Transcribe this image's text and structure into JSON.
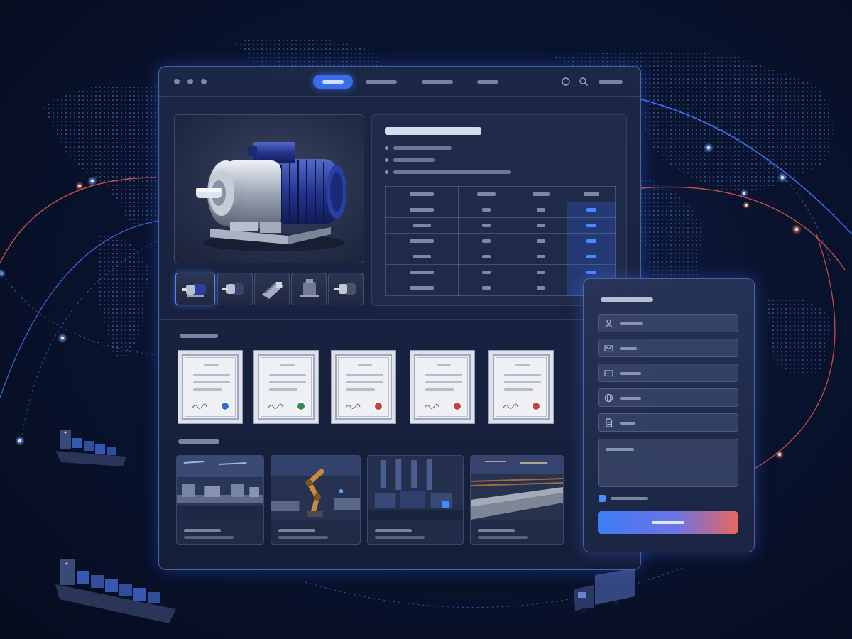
{
  "window": {
    "controls": [
      "window-dot",
      "window-dot",
      "window-dot"
    ],
    "nav_tabs": [
      {
        "label": "",
        "active": true
      },
      {
        "label": "",
        "active": false
      },
      {
        "label": "",
        "active": false
      },
      {
        "label": "",
        "active": false
      }
    ],
    "toolbar_icons": [
      "circle-icon",
      "search-icon",
      "menu-placeholder"
    ]
  },
  "product": {
    "hero_icon": "electric-motor-image",
    "thumbnails": [
      {
        "icon": "motor-thumbnail-icon",
        "active": true
      },
      {
        "icon": "motor-thumbnail-icon",
        "active": false
      },
      {
        "icon": "gearbox-thumbnail-icon",
        "active": false
      },
      {
        "icon": "motor-thumbnail-icon",
        "active": false
      },
      {
        "icon": "motor-thumbnail-icon",
        "active": false
      }
    ],
    "spec_title": "",
    "bullets": [
      "",
      "",
      ""
    ],
    "table": {
      "columns": 4,
      "rows": 6,
      "highlighted_column": 3
    }
  },
  "certificates": {
    "section_label": "",
    "items": [
      {
        "seal_color": "#2f6fd1"
      },
      {
        "seal_color": "#2e8c52"
      },
      {
        "seal_color": "#c8403a"
      },
      {
        "seal_color": "#c8403a"
      },
      {
        "seal_color": "#c8403a"
      }
    ]
  },
  "factory": {
    "section_label": "",
    "cards": [
      {
        "icon": "factory-production-line-image",
        "caption": "",
        "subcaption": ""
      },
      {
        "icon": "robotic-arm-image",
        "caption": "",
        "subcaption": ""
      },
      {
        "icon": "machinery-floor-image",
        "caption": "",
        "subcaption": ""
      },
      {
        "icon": "pipe-production-image",
        "caption": "",
        "subcaption": ""
      }
    ]
  },
  "contact_form": {
    "title": "",
    "fields": [
      {
        "icon": "user-icon",
        "placeholder": ""
      },
      {
        "icon": "mail-icon",
        "placeholder": ""
      },
      {
        "icon": "card-icon",
        "placeholder": ""
      },
      {
        "icon": "globe-icon",
        "placeholder": ""
      },
      {
        "icon": "document-icon",
        "placeholder": ""
      }
    ],
    "message_placeholder": "",
    "checkbox_checked": true,
    "checkbox_label": "",
    "submit_label": ""
  },
  "colors": {
    "accent_blue": "#3a6ee8",
    "accent_red": "#e8665e",
    "background": "#0a1430"
  },
  "background_icons": [
    "world-map-dots",
    "route-arcs",
    "cargo-ship-icon",
    "cargo-ship-icon",
    "truck-icon"
  ]
}
